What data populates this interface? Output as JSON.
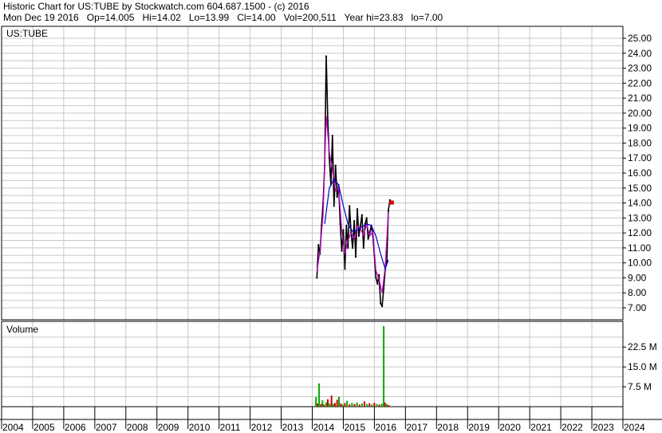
{
  "header": {
    "line1": "Historic Chart for US:TUBE by Stockwatch.com 604.687.1500 - (c) 2016",
    "line2": "Mon Dec 19 2016   Op=14.005   Hi=14.02   Lo=13.99   Cl=14.00   Vol=200,511   Year hi=23.83   lo=7.00"
  },
  "colors": {
    "grid": "#c8c8c8",
    "frame": "#000000",
    "price": "#000000",
    "ma_fast": "#cc00cc",
    "ma_slow": "#0000cc",
    "vol_up": "#00aa00",
    "vol_down": "#cc0000",
    "last_marker": "#cc0000"
  },
  "chart_data": [
    {
      "type": "line",
      "title": "US:TUBE",
      "ylim": [
        6.2,
        25.8
      ],
      "y_ticks": [
        "25.00",
        "24.00",
        "23.00",
        "22.00",
        "21.00",
        "20.00",
        "19.00",
        "18.00",
        "17.00",
        "16.00",
        "15.00",
        "14.00",
        "13.00",
        "12.00",
        "11.00",
        "10.00",
        "9.00",
        "8.00",
        "7.00"
      ],
      "x_ticks": [
        "2004",
        "2005",
        "2006",
        "2007",
        "2008",
        "2009",
        "2010",
        "2011",
        "2012",
        "2013",
        "2014",
        "2015",
        "2016",
        "2017",
        "2018",
        "2019",
        "2020",
        "2021",
        "2022",
        "2023",
        "2024"
      ],
      "xlim": [
        2004.0,
        2024.0
      ],
      "series": [
        {
          "name": "",
          "x": [
            2014.15,
            2014.2,
            2014.25,
            2014.3,
            2014.35,
            2014.4,
            2014.45,
            2014.5,
            2014.55,
            2014.6,
            2014.65,
            2014.7,
            2014.75,
            2014.8,
            2014.85,
            2014.9,
            2014.95,
            2015.0,
            2015.05,
            2015.1,
            2015.15,
            2015.2,
            2015.25,
            2015.3,
            2015.35,
            2015.4,
            2015.45,
            2015.5,
            2015.55,
            2015.6,
            2015.65,
            2015.7,
            2015.75,
            2015.8,
            2015.85,
            2015.9,
            2015.95,
            2016.0,
            2016.05,
            2016.1,
            2016.15,
            2016.2,
            2016.25,
            2016.3,
            2016.35,
            2016.4,
            2016.42,
            2016.45,
            2016.5,
            2016.55
          ],
          "y": [
            9.0,
            11.2,
            10.6,
            12.5,
            14.0,
            16.5,
            23.8,
            19.5,
            17.0,
            15.2,
            18.5,
            13.8,
            16.5,
            14.4,
            15.2,
            12.6,
            10.8,
            12.2,
            9.6,
            12.5,
            11.0,
            13.8,
            12.0,
            11.0,
            12.8,
            10.4,
            13.6,
            11.8,
            12.5,
            13.2,
            11.0,
            12.6,
            13.0,
            11.6,
            12.0,
            12.5,
            11.8,
            10.5,
            9.0,
            8.6,
            9.2,
            7.3,
            7.1,
            8.3,
            9.6,
            10.1,
            11.6,
            13.5,
            14.2,
            14.0
          ]
        },
        {
          "name": "",
          "x": [
            2014.15,
            2014.25,
            2014.35,
            2014.45,
            2014.55,
            2014.65,
            2014.75,
            2014.85,
            2014.95,
            2015.05,
            2015.15,
            2015.25,
            2015.35,
            2015.45,
            2015.55,
            2015.65,
            2015.75,
            2015.85,
            2015.95,
            2016.05,
            2016.15,
            2016.25,
            2016.35,
            2016.45
          ],
          "y": [
            9.4,
            10.8,
            13.2,
            19.8,
            17.4,
            16.2,
            14.8,
            15.0,
            12.2,
            10.6,
            11.5,
            12.0,
            11.6,
            12.5,
            12.3,
            11.8,
            12.6,
            11.8,
            12.1,
            9.5,
            8.9,
            8.0,
            9.8,
            13.4
          ]
        },
        {
          "name": "",
          "x": [
            2014.4,
            2014.55,
            2014.7,
            2014.85,
            2015.0,
            2015.15,
            2015.3,
            2015.45,
            2015.6,
            2015.75,
            2015.9,
            2016.05,
            2016.2,
            2016.35,
            2016.45
          ],
          "y": [
            12.6,
            15.0,
            15.6,
            15.2,
            13.8,
            12.6,
            12.1,
            12.2,
            12.4,
            12.6,
            12.5,
            11.8,
            10.6,
            9.6,
            10.2
          ]
        }
      ]
    },
    {
      "type": "bar",
      "title": "Volume",
      "ylim": [
        0,
        31
      ],
      "y_ticks": [
        "22.5 M",
        "15.0 M",
        "7.5 M"
      ],
      "x": [
        2014.12,
        2014.17,
        2014.22,
        2014.28,
        2014.33,
        2014.38,
        2014.45,
        2014.5,
        2014.56,
        2014.62,
        2014.68,
        2014.73,
        2014.8,
        2014.86,
        2014.92,
        2014.98,
        2015.05,
        2015.12,
        2015.2,
        2015.28,
        2015.36,
        2015.44,
        2015.52,
        2015.6,
        2015.68,
        2015.76,
        2015.84,
        2015.92,
        2016.0,
        2016.08,
        2016.16,
        2016.24,
        2016.3,
        2016.34,
        2016.4,
        2016.46
      ],
      "values": [
        3.6,
        1.2,
        8.8,
        1.0,
        2.4,
        0.8,
        1.6,
        2.8,
        1.2,
        4.2,
        1.0,
        1.4,
        2.6,
        3.8,
        1.2,
        0.8,
        1.4,
        2.2,
        0.9,
        1.4,
        1.0,
        1.6,
        0.8,
        1.2,
        2.0,
        1.0,
        1.3,
        0.9,
        1.5,
        1.0,
        0.8,
        1.2,
        30.4,
        1.6,
        1.0,
        0.6
      ],
      "up": [
        true,
        false,
        true,
        false,
        true,
        false,
        true,
        false,
        true,
        false,
        true,
        false,
        false,
        true,
        false,
        true,
        false,
        true,
        false,
        true,
        false,
        true,
        false,
        true,
        false,
        true,
        false,
        true,
        false,
        true,
        false,
        true,
        true,
        false,
        true,
        false
      ]
    }
  ]
}
